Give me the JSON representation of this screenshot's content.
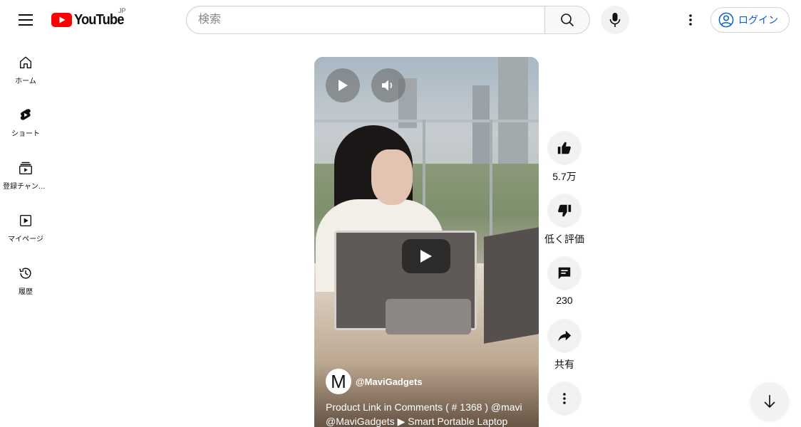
{
  "header": {
    "logo_text": "YouTube",
    "region": "JP",
    "search_placeholder": "検索",
    "signin_label": "ログイン"
  },
  "sidebar": {
    "items": [
      {
        "label": "ホーム",
        "icon": "home-icon"
      },
      {
        "label": "ショート",
        "icon": "shorts-icon"
      },
      {
        "label": "登録チャンネル",
        "icon": "subscriptions-icon"
      },
      {
        "label": "マイページ",
        "icon": "library-icon"
      },
      {
        "label": "履歴",
        "icon": "history-icon"
      }
    ]
  },
  "short": {
    "channel_avatar_letter": "M",
    "channel_name": "@MaviGadgets",
    "title": "Product Link in Comments ( # 1368 ) @mavi @MaviGadgets ▶ Smart Portable Laptop"
  },
  "actions": {
    "like_count": "5.7万",
    "dislike_label": "低く評価",
    "comment_count": "230",
    "share_label": "共有"
  },
  "colors": {
    "brand_red": "#ff0000",
    "link_blue": "#065fd4"
  }
}
